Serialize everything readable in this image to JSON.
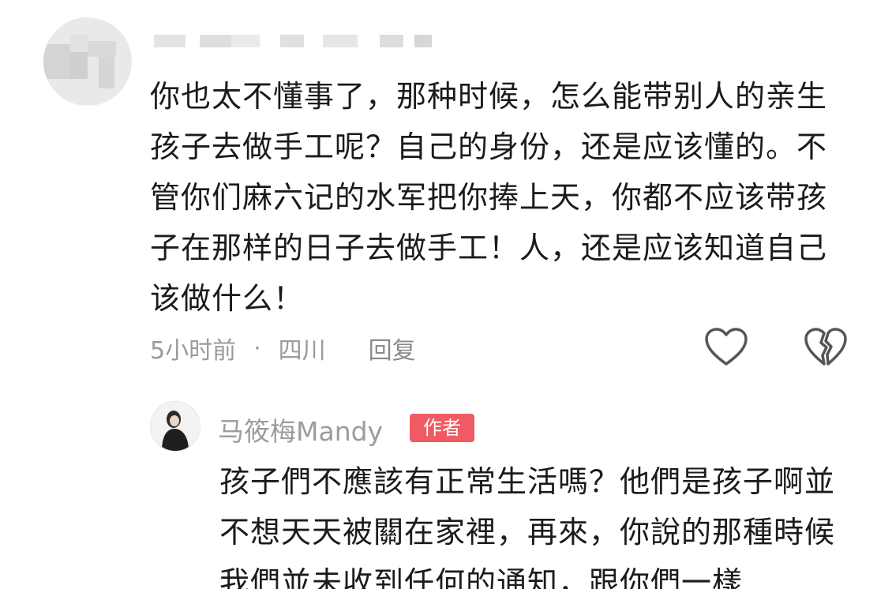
{
  "comment": {
    "text": "你也太不懂事了，那种时候，怎么能带别人的亲生孩子去做手工呢？自己的身份，还是应该懂的。不管你们麻六记的水军把你捧上天，你都不应该带孩子在那样的日子去做手工！人，还是应该知道自己该做什么！",
    "time": "5小时前",
    "separator": "·",
    "location": "四川",
    "reply_label": "回复",
    "like_icon": "heart-outline",
    "dislike_icon": "broken-heart-outline"
  },
  "reply": {
    "author_name": "马筱梅Mandy",
    "badge": "作者",
    "text": "孩子們不應該有正常生活嗎？他們是孩子啊並不想天天被關在家裡，再來，你說的那種時候我們並未收到任何的通知，跟你們一樣",
    "colors": {
      "badge_bg": "#f05a62"
    }
  }
}
